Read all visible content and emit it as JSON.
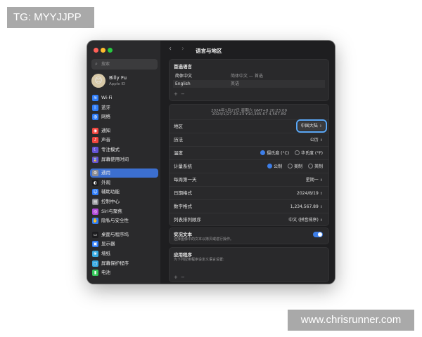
{
  "watermarks": {
    "top_left": "TG: MYYJJPP",
    "bottom_right": "www.chrisrunner.com"
  },
  "window": {
    "title": "语言与地区"
  },
  "sidebar": {
    "search_placeholder": "搜索",
    "user": {
      "name": "Billy Fu",
      "subtitle": "Apple ID"
    },
    "items": [
      {
        "label": "Wi-Fi",
        "icon": "wifi-icon",
        "color": "#2f7cf6",
        "glyph": "≋"
      },
      {
        "label": "蓝牙",
        "icon": "bluetooth-icon",
        "color": "#2f7cf6",
        "glyph": "ᛒ"
      },
      {
        "label": "网络",
        "icon": "network-icon",
        "color": "#2f7cf6",
        "glyph": "◍"
      },
      {
        "label": "通知",
        "icon": "notifications-icon",
        "color": "#f0463f",
        "glyph": "◉"
      },
      {
        "label": "声音",
        "icon": "sound-icon",
        "color": "#f0463f",
        "glyph": "♪"
      },
      {
        "label": "专注模式",
        "icon": "focus-icon",
        "color": "#6353d6",
        "glyph": "☾"
      },
      {
        "label": "屏幕使用时间",
        "icon": "screen-time-icon",
        "color": "#6353d6",
        "glyph": "⌛"
      },
      {
        "label": "通用",
        "icon": "general-icon",
        "color": "#8e8e93",
        "glyph": "⚙"
      },
      {
        "label": "外观",
        "icon": "appearance-icon",
        "color": "#1c1c1e",
        "glyph": "◐"
      },
      {
        "label": "辅助功能",
        "icon": "accessibility-icon",
        "color": "#2f7cf6",
        "glyph": "☺"
      },
      {
        "label": "控制中心",
        "icon": "control-center-icon",
        "color": "#8e8e93",
        "glyph": "▤"
      },
      {
        "label": "Siri与聚焦",
        "icon": "siri-icon",
        "color": "#b04ad8",
        "glyph": "◎"
      },
      {
        "label": "隐私与安全性",
        "icon": "privacy-icon",
        "color": "#2f7cf6",
        "glyph": "✋"
      },
      {
        "label": "桌面与程序坞",
        "icon": "desktop-dock-icon",
        "color": "#1c1c1e",
        "glyph": "▭"
      },
      {
        "label": "显示器",
        "icon": "displays-icon",
        "color": "#2f7cf6",
        "glyph": "▣"
      },
      {
        "label": "墙纸",
        "icon": "wallpaper-icon",
        "color": "#36a8e0",
        "glyph": "❀"
      },
      {
        "label": "屏幕保护程序",
        "icon": "screen-saver-icon",
        "color": "#36a8e0",
        "glyph": "▢"
      },
      {
        "label": "电池",
        "icon": "battery-icon",
        "color": "#34c759",
        "glyph": "▮"
      }
    ]
  },
  "preferred": {
    "title": "首选语言",
    "languages": [
      {
        "name": "简体中文",
        "desc": "简体中文 — 首选"
      },
      {
        "name": "English",
        "desc": "英语"
      }
    ],
    "add": "+",
    "remove": "−"
  },
  "formats": {
    "preview_line1": "2024年1月27日 星期六 GMT+8 20:23:09",
    "preview_line2": "2024/1/27 20:23    ¥10,345.67    4,567.89",
    "rows": {
      "region": {
        "label": "地区",
        "value": "中国大陆"
      },
      "calendar": {
        "label": "历法",
        "value": "公历"
      },
      "temperature": {
        "label": "温度",
        "opt1": "摄氏度 (°C)",
        "opt2": "华氏度 (°F)"
      },
      "measurement": {
        "label": "计量系统",
        "opt1": "公制",
        "opt2": "美制",
        "opt3": "英制"
      },
      "first_day": {
        "label": "每周第一天",
        "value": "星期一"
      },
      "date_format": {
        "label": "日期格式",
        "value": "2024/8/19"
      },
      "number_format": {
        "label": "数字格式",
        "value": "1,234,567.89"
      },
      "sort_order": {
        "label": "列表排列顺序",
        "value": "中文 (拼音排序)"
      }
    }
  },
  "live_text": {
    "title": "实况文本",
    "subtitle": "选择图像中的文本以拷贝或进行操作。",
    "enabled": true
  },
  "apps": {
    "title": "应用程序",
    "subtitle": "为下列应用程序设定义语言设置:",
    "add": "+",
    "remove": "−"
  },
  "colors": {
    "accent": "#3d7ee8",
    "highlight": "#5aa6f4"
  }
}
